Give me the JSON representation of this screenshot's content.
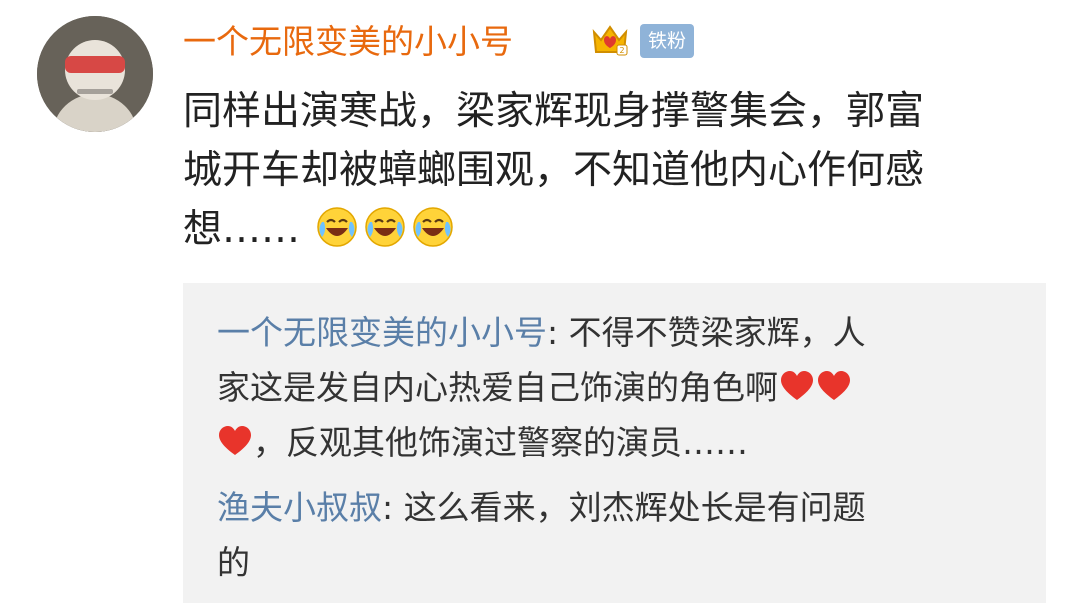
{
  "post": {
    "username": "一个无限变美的小小号",
    "badge": "铁粉",
    "text_lines": [
      "同样出演寒战，梁家辉现身撑警集会，郭富",
      "城开车却被蟑螂围观，不知道他内心作何感",
      "想……"
    ],
    "emoji_count": 3,
    "emoji_icon": "laughing-crying-emoji-icon"
  },
  "replies": [
    {
      "name": "一个无限变美的小小号",
      "text_lines": [
        ": 不得不赞梁家辉，人",
        "家这是发自内心热爱自己饰演的角色啊",
        "，反观其他饰演过警察的演员……"
      ],
      "heart_icon": "red-heart-icon"
    },
    {
      "name": "渔夫小叔叔",
      "text_lines": [
        ": 这么看来，刘杰辉处长是有问题",
        "的"
      ]
    }
  ],
  "colors": {
    "username": "#e8690e",
    "reply_name": "#5a7fa8",
    "badge_bg": "#8fb3d8",
    "reply_bg": "#f2f2f2"
  }
}
